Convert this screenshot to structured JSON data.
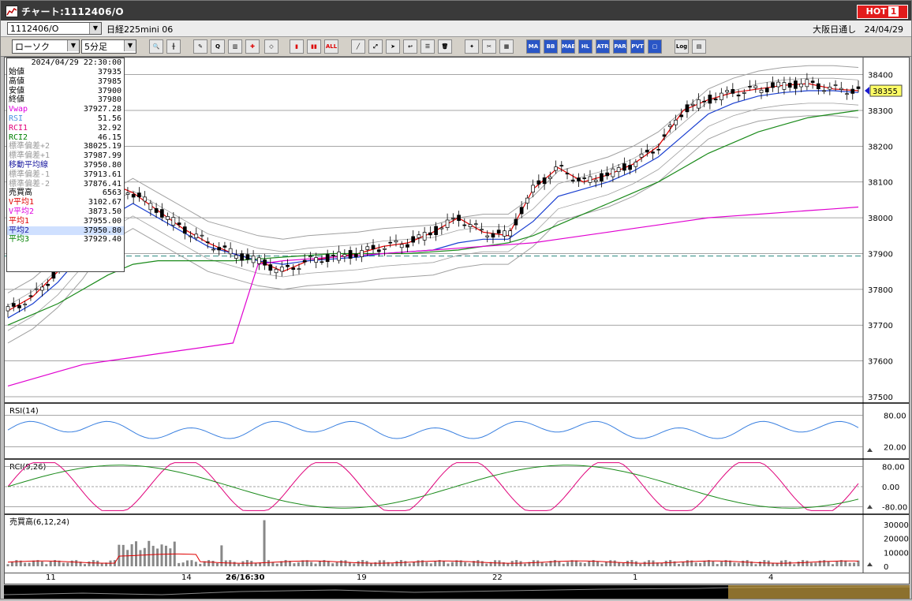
{
  "window": {
    "title": "チャート:1112406/O",
    "hot_label": "HOT",
    "hot_num": "1"
  },
  "infobar": {
    "symbol": "1112406/O",
    "instrument": "日経225mini 06",
    "market": "大阪日通し",
    "date": "24/04/29"
  },
  "toolbar": {
    "chart_type": "ローソク",
    "period": "5分足",
    "buttons": [
      "ALL",
      "MA",
      "BB",
      "MAE",
      "HL",
      "ATR",
      "PAR",
      "PVT",
      "Log"
    ]
  },
  "data_panel": {
    "datetime": "2024/04/29  22:30:00",
    "rows": [
      {
        "k": "始値",
        "v": "37935",
        "c": "#000"
      },
      {
        "k": "高値",
        "v": "37985",
        "c": "#000"
      },
      {
        "k": "安値",
        "v": "37900",
        "c": "#000"
      },
      {
        "k": "終値",
        "v": "37980",
        "c": "#000"
      },
      {
        "k": "Vwap",
        "v": "37927.28",
        "c": "#e000e0"
      },
      {
        "k": "RSI",
        "v": "51.56",
        "c": "#4a90e2"
      },
      {
        "k": "RCI1",
        "v": "32.92",
        "c": "#e0007a"
      },
      {
        "k": "RCI2",
        "v": "46.15",
        "c": "#008000"
      },
      {
        "k": "標準偏差+2",
        "v": "38025.19",
        "c": "#999"
      },
      {
        "k": "標準偏差+1",
        "v": "37987.99",
        "c": "#999"
      },
      {
        "k": "移動平均線",
        "v": "37950.80",
        "c": "#1a1aa0"
      },
      {
        "k": "標準偏差-1",
        "v": "37913.61",
        "c": "#999"
      },
      {
        "k": "標準偏差-2",
        "v": "37876.41",
        "c": "#999"
      },
      {
        "k": "売買高",
        "v": "6563",
        "c": "#000"
      },
      {
        "k": "V平均1",
        "v": "3102.67",
        "c": "#e00000"
      },
      {
        "k": "V平均2",
        "v": "3873.50",
        "c": "#e000e0"
      },
      {
        "k": "平均1",
        "v": "37955.00",
        "c": "#e00000"
      },
      {
        "k": "平均2",
        "v": "37950.80",
        "c": "#1a1aa0"
      },
      {
        "k": "平均3",
        "v": "37929.40",
        "c": "#008000"
      }
    ]
  },
  "price_axis": {
    "labels": [
      "38400",
      "38300",
      "38200",
      "38100",
      "38000",
      "37900",
      "37800",
      "37700",
      "37600",
      "37500"
    ],
    "current_price": "38355",
    "ylim": [
      37500,
      38430
    ]
  },
  "rsi_panel": {
    "title": "RSI(14)",
    "labels": [
      "80.00",
      "20.00"
    ]
  },
  "rci_panel": {
    "title": "RCI(9,26)",
    "labels": [
      "80.00",
      "0.00",
      "-80.00"
    ]
  },
  "volume_panel": {
    "title": "売買高(6,12,24)",
    "labels": [
      "30000",
      "20000",
      "10000",
      "0"
    ]
  },
  "time_axis": {
    "labels": [
      "11",
      "14",
      "26/16:30",
      "19",
      "22",
      "1",
      "4"
    ]
  },
  "colors": {
    "bb": "#a0a0a0",
    "ma_short": "#e00000",
    "ma_mid": "#1a3fd0",
    "ma_long": "#1a8a1a",
    "vwap": "#e000d0",
    "rsi": "#3a80e0",
    "rci1": "#e0007a",
    "rci2": "#1a8a1a"
  },
  "chart_data": {
    "type": "line",
    "instrument": "日経225mini 06",
    "timeframe": "5分足",
    "series": [
      {
        "name": "平均1",
        "values": [
          37740,
          37780,
          37850,
          37960,
          38100,
          38070,
          38020,
          37970,
          37930,
          37900,
          37880,
          37850,
          37880,
          37890,
          37900,
          37920,
          37930,
          37960,
          38000,
          37960,
          37950,
          38080,
          38140,
          38100,
          38120,
          38150,
          38200,
          38300,
          38330,
          38350,
          38360,
          38370,
          38375,
          38360,
          38355
        ]
      },
      {
        "name": "平均2",
        "values": [
          37720,
          37760,
          37820,
          37900,
          38000,
          38040,
          38000,
          37960,
          37920,
          37900,
          37880,
          37870,
          37880,
          37885,
          37890,
          37900,
          37905,
          37910,
          37930,
          37940,
          37940,
          37990,
          38060,
          38080,
          38100,
          38130,
          38170,
          38230,
          38290,
          38320,
          38340,
          38350,
          38355,
          38355,
          38350
        ]
      },
      {
        "name": "平均3",
        "values": [
          37700,
          37730,
          37760,
          37800,
          37840,
          37870,
          37880,
          37880,
          37880,
          37880,
          37885,
          37890,
          37895,
          37900,
          37900,
          37900,
          37900,
          37905,
          37910,
          37920,
          37930,
          37950,
          37980,
          38010,
          38040,
          38070,
          38100,
          38140,
          38180,
          38210,
          38240,
          38260,
          38280,
          38290,
          38300
        ]
      },
      {
        "name": "Vwap",
        "values": [
          37530,
          37550,
          37570,
          37590,
          37600,
          37610,
          37620,
          37630,
          37640,
          37650,
          37870,
          37880,
          37885,
          37890,
          37895,
          37900,
          37905,
          37910,
          37915,
          37920,
          37925,
          37930,
          37940,
          37950,
          37960,
          37970,
          37980,
          37990,
          38000,
          38005,
          38010,
          38015,
          38020,
          38025,
          38030
        ]
      }
    ],
    "ylim": [
      37500,
      38430
    ]
  }
}
